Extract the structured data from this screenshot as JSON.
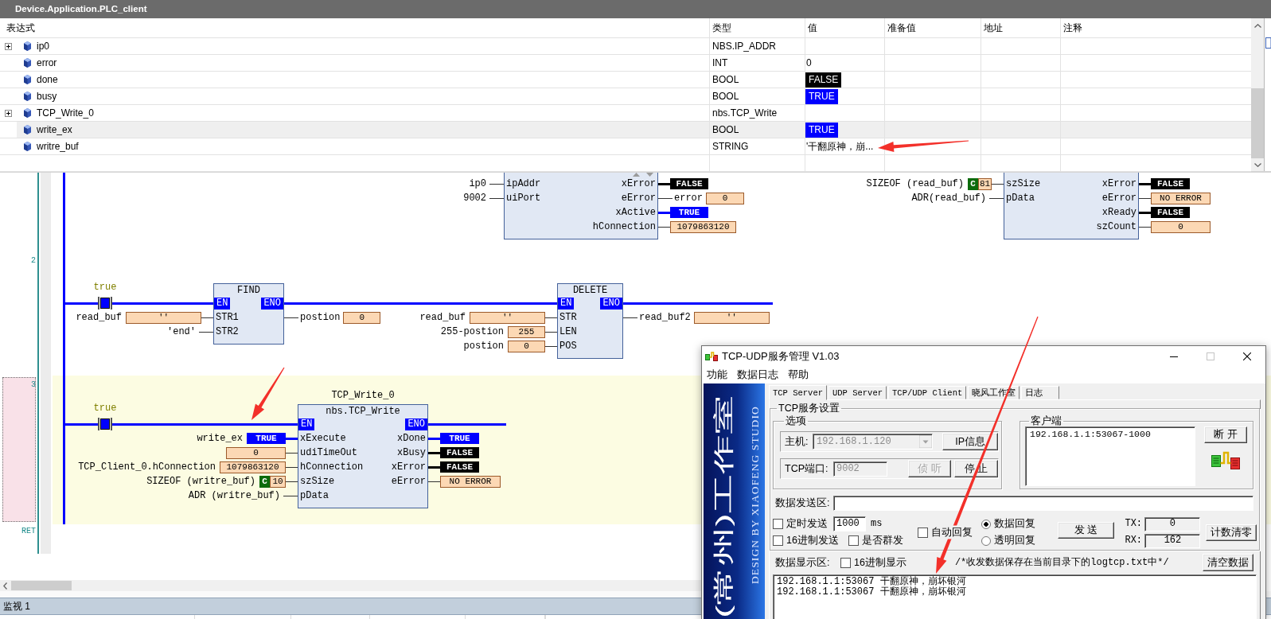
{
  "watch": {
    "title": "Device.Application.PLC_client",
    "columns": [
      "表达式",
      "类型",
      "值",
      "准备值",
      "地址",
      "注释"
    ],
    "rows": [
      {
        "kind": "struct",
        "expanded": false,
        "expression": "ip0",
        "type": "NBS.IP_ADDR",
        "selected": false
      },
      {
        "kind": "scalar",
        "expression": "error",
        "type": "INT",
        "value": {
          "kind": "data",
          "text": "0"
        },
        "selected": false
      },
      {
        "kind": "scalar",
        "expression": "done",
        "type": "BOOL",
        "value": {
          "kind": "bool",
          "text": "FALSE",
          "on": false
        },
        "selected": false
      },
      {
        "kind": "scalar",
        "expression": "busy",
        "type": "BOOL",
        "value": {
          "kind": "bool",
          "text": "TRUE",
          "on": true
        },
        "selected": false
      },
      {
        "kind": "struct",
        "expanded": false,
        "expression": "TCP_Write_0",
        "type": "nbs.TCP_Write",
        "selected": false
      },
      {
        "kind": "scalar",
        "expression": "write_ex",
        "type": "BOOL",
        "value": {
          "kind": "bool",
          "text": "TRUE",
          "on": true
        },
        "selected": true
      },
      {
        "kind": "scalar",
        "expression": "writre_buf",
        "type": "STRING",
        "value": {
          "kind": "data",
          "text": "'干翻原神，崩..."
        },
        "selected": false
      }
    ]
  },
  "ladder": {
    "networks": [
      {
        "selected": false,
        "blocks": [
          {
            "inputs": [
              {
                "pin": "ipAddr",
                "source": "ip0"
              },
              {
                "pin": "uiPort",
                "source": "9002"
              }
            ],
            "outputs": [
              {
                "pin": "xError",
                "value": {
                  "kind": "bool",
                  "text": "FALSE",
                  "on": false
                }
              },
              {
                "pin": "eError",
                "target": "error",
                "value": {
                  "kind": "data",
                  "text": "0"
                }
              },
              {
                "pin": "xActive",
                "value": {
                  "kind": "bool",
                  "text": "TRUE",
                  "on": true
                }
              },
              {
                "pin": "hConnection",
                "value": {
                  "kind": "data",
                  "text": "1079863120"
                }
              }
            ]
          },
          {
            "inputs": [
              {
                "pin": "szSize",
                "source": "SIZEOF (read_buf)",
                "value": {
                  "kind": "data",
                  "tag": "C",
                  "text": "81"
                }
              },
              {
                "pin": "pData",
                "source": "ADR(read_buf)"
              }
            ],
            "outputs": [
              {
                "pin": "xError",
                "value": {
                  "kind": "bool",
                  "text": "FALSE",
                  "on": false
                }
              },
              {
                "pin": "eError",
                "value": {
                  "kind": "data",
                  "text": "NO ERROR"
                }
              },
              {
                "pin": "xReady",
                "value": {
                  "kind": "bool",
                  "text": "FALSE",
                  "on": false
                }
              },
              {
                "pin": "szCount",
                "value": {
                  "kind": "data",
                  "text": "0"
                }
              }
            ]
          }
        ]
      },
      {
        "number": "2",
        "selected": false,
        "contact": {
          "label": "true",
          "on": true
        },
        "blocks": [
          {
            "type": "FIND",
            "enable": {
              "in": "EN",
              "out": "ENO"
            },
            "inputs": [
              {
                "pin": "STR1",
                "source": "read_buf",
                "value": {
                  "kind": "data",
                  "text": "''"
                }
              },
              {
                "pin": "STR2",
                "source": "'end'"
              }
            ],
            "outputs": [
              {
                "target": "postion",
                "value": {
                  "kind": "data",
                  "text": "0"
                }
              }
            ]
          },
          {
            "type": "DELETE",
            "enable": {
              "in": "EN",
              "out": "ENO"
            },
            "inputs": [
              {
                "pin": "STR",
                "source": "read_buf",
                "value": {
                  "kind": "data",
                  "text": "''"
                }
              },
              {
                "pin": "LEN",
                "source": "255-postion",
                "value": {
                  "kind": "data",
                  "text": "255"
                }
              },
              {
                "pin": "POS",
                "source": "postion",
                "value": {
                  "kind": "data",
                  "text": "0"
                }
              }
            ],
            "outputs": [
              {
                "target": "read_buf2",
                "value": {
                  "kind": "data",
                  "text": "''"
                }
              }
            ]
          }
        ]
      },
      {
        "number": "3",
        "selected": true,
        "contact": {
          "label": "true",
          "on": true
        },
        "blocks": [
          {
            "instance": "TCP_Write_0",
            "type": "nbs.TCP_Write",
            "enable": {
              "in": "EN",
              "out": "ENO"
            },
            "inputs": [
              {
                "pin": "xExecute",
                "source": "write_ex",
                "value": {
                  "kind": "bool",
                  "text": "TRUE",
                  "on": true
                }
              },
              {
                "pin": "udiTimeOut",
                "value": {
                  "kind": "data",
                  "text": "0"
                }
              },
              {
                "pin": "hConnection",
                "source": "TCP_Client_0.hConnection",
                "value": {
                  "kind": "data",
                  "text": "1079863120"
                }
              },
              {
                "pin": "szSize",
                "source": "SIZEOF (writre_buf)",
                "value": {
                  "kind": "data",
                  "tag": "C",
                  "text": "10"
                }
              },
              {
                "pin": "pData",
                "source": "ADR (writre_buf)"
              }
            ],
            "outputs": [
              {
                "pin": "xDone",
                "value": {
                  "kind": "bool",
                  "text": "TRUE",
                  "on": true
                }
              },
              {
                "pin": "xBusy",
                "value": {
                  "kind": "bool",
                  "text": "FALSE",
                  "on": false
                }
              },
              {
                "pin": "xError",
                "value": {
                  "kind": "bool",
                  "text": "FALSE",
                  "on": false
                }
              },
              {
                "pin": "eError",
                "value": {
                  "kind": "data",
                  "text": "NO ERROR"
                }
              }
            ]
          }
        ]
      }
    ],
    "end_label": "RET"
  },
  "bottom_panel": {
    "tab": "监视 1"
  },
  "tcp_window": {
    "title": "TCP-UDP服务管理 V1.03",
    "window_controls": [
      {
        "kind": "minimize",
        "disabled": false
      },
      {
        "kind": "maximize",
        "disabled": true
      },
      {
        "kind": "close",
        "disabled": false
      }
    ],
    "menu": [
      "功能",
      "数据日志",
      "帮助"
    ],
    "banner": {
      "title": "(常州)工作室",
      "subtitle": "DESIGN BY XIAOFENG STUDIO"
    },
    "tabs": [
      {
        "label": "TCP Server",
        "selected": true
      },
      {
        "label": "UDP Server",
        "selected": false
      },
      {
        "label": "TCP/UDP Client",
        "selected": false
      },
      {
        "label": "晓风工作室",
        "selected": false
      },
      {
        "label": "日志",
        "selected": false
      }
    ],
    "settings": {
      "title": "TCP服务设置",
      "options": {
        "title": "选项",
        "host_label": "主机:",
        "host": {
          "value": "192.168.1.120",
          "disabled": true
        },
        "ip_info_button": {
          "label": "IP信息",
          "disabled": false
        },
        "port_label": "TCP端口:",
        "port": {
          "value": "9002",
          "disabled": true
        },
        "listen_button": {
          "label": "侦 听",
          "disabled": true
        },
        "stop_button": {
          "label": "停 止",
          "disabled": false
        }
      },
      "clients": {
        "title": "客户端",
        "items": [
          "192.168.1.1:53067-1000"
        ],
        "disconnect_button": "断 开"
      },
      "send_label": "数据发送区:",
      "timed_send": {
        "label": "定时发送",
        "checked": false
      },
      "interval": "1000",
      "interval_unit": "ms",
      "hex_send": {
        "label": "16进制发送",
        "checked": false
      },
      "group_send": {
        "label": "是否群发",
        "checked": false
      },
      "auto_reply": {
        "label": "自动回复",
        "checked": false
      },
      "reply_modes": [
        {
          "label": "数据回复",
          "selected": true
        },
        {
          "label": "透明回复",
          "selected": false
        }
      ],
      "send_button": "发 送",
      "tx_label": "TX:",
      "tx": "0",
      "rx_label": "RX:",
      "rx": "162",
      "reset_button": "计数清零"
    },
    "display": {
      "label": "数据显示区:",
      "hex_display": {
        "label": "16进制显示",
        "checked": false
      },
      "note": "/*收发数据保存在当前目录下的logtcp.txt中*/",
      "clear_button": "清空数据",
      "lines": [
        "192.168.1.1:53067 干翻原神，崩坏银河",
        "192.168.1.1:53067 干翻原神，崩坏银河"
      ]
    }
  }
}
